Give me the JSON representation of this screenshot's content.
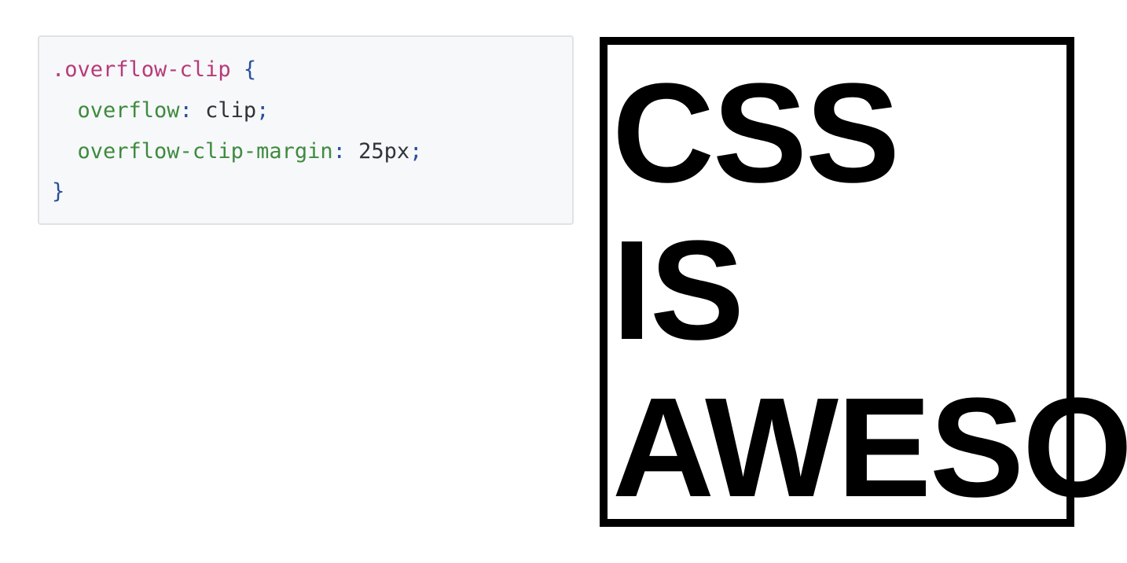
{
  "code_block": {
    "line1": {
      "selector": ".overflow-clip",
      "brace_open": "{"
    },
    "line2": {
      "indent": "  ",
      "property": "overflow",
      "colon": ":",
      "value": " clip",
      "semicolon": ";"
    },
    "line3": {
      "indent": "  ",
      "property": "overflow-clip-margin",
      "colon": ":",
      "value": " 25px",
      "semicolon": ";"
    },
    "line4": {
      "brace_close": "}"
    }
  },
  "demo": {
    "words": [
      "CSS",
      "IS",
      "AWESOME"
    ]
  },
  "colors": {
    "selector": "#b83a79",
    "punctuation": "#2b4f9e",
    "property": "#3f8a3f",
    "value": "#2f3337",
    "code_background": "#f6f8fa",
    "box_border": "#000000"
  }
}
